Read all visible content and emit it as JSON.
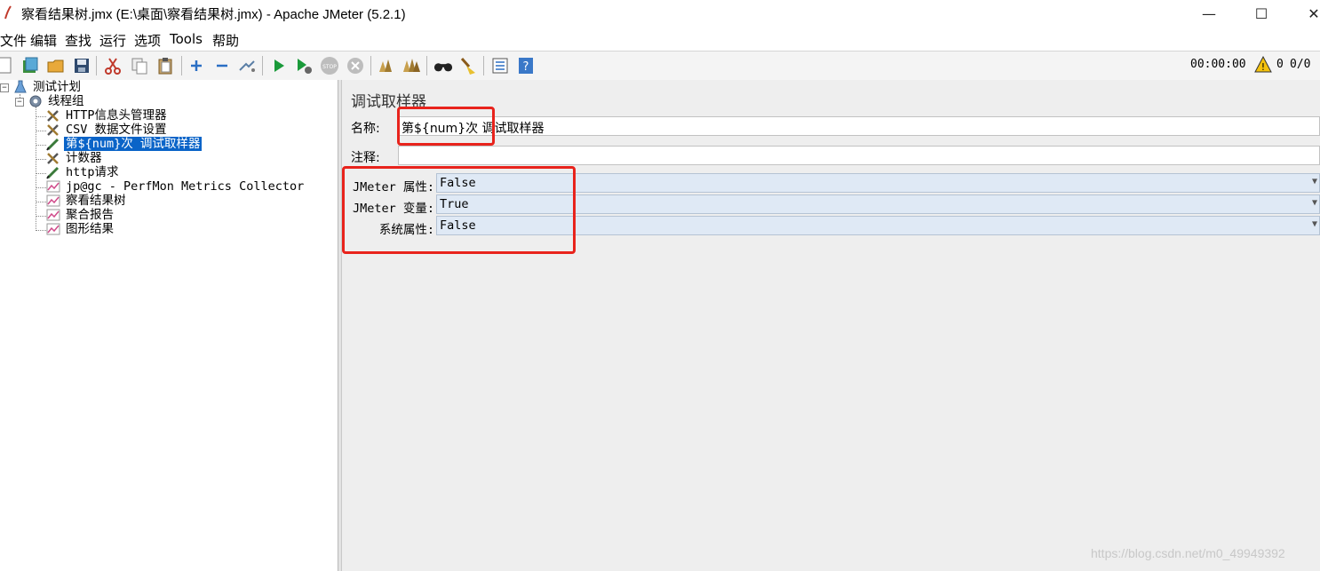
{
  "window": {
    "title": "察看结果树.jmx (E:\\桌面\\察看结果树.jmx) - Apache JMeter (5.2.1)",
    "minimize": "—",
    "maximize": "☐",
    "close": "✕"
  },
  "menu": [
    "文件",
    "编辑",
    "查找",
    "运行",
    "选项",
    "Tools",
    "帮助"
  ],
  "toolbar": {
    "icons": [
      "new-icon",
      "templates-icon",
      "open-icon",
      "save-icon",
      "cut-icon",
      "copy-icon",
      "paste-icon",
      "expand-icon",
      "collapse-icon",
      "toggle-icon",
      "start-icon",
      "start-no-pause-icon",
      "stop-icon",
      "shutdown-icon",
      "clear-icon",
      "clear-all-icon",
      "search-icon",
      "reset-search-icon",
      "function-helper-icon",
      "help-icon"
    ],
    "timer": "00:00:00",
    "warning_count": "0",
    "threads": "0/0"
  },
  "tree": {
    "items": [
      {
        "label": "测试计划",
        "icon": "test-plan-icon"
      },
      {
        "label": "线程组",
        "icon": "thread-group-icon"
      },
      {
        "label": "HTTP信息头管理器",
        "icon": "config-element-icon"
      },
      {
        "label": "CSV 数据文件设置",
        "icon": "config-element-icon"
      },
      {
        "label": "第${num}次 调试取样器",
        "icon": "sampler-icon"
      },
      {
        "label": "计数器",
        "icon": "config-element-icon"
      },
      {
        "label": "http请求",
        "icon": "sampler-icon"
      },
      {
        "label": "jp@gc - PerfMon Metrics Collector",
        "icon": "listener-icon"
      },
      {
        "label": "察看结果树",
        "icon": "listener-icon"
      },
      {
        "label": "聚合报告",
        "icon": "listener-icon"
      },
      {
        "label": "图形结果",
        "icon": "listener-icon"
      }
    ],
    "selected_index": 4
  },
  "panel": {
    "title": "调试取样器",
    "name_label": "名称:",
    "name_value": "第${num}次 调试取样器",
    "comment_label": "注释:",
    "comment_value": "",
    "properties": [
      {
        "label": "JMeter 属性:",
        "value": "False"
      },
      {
        "label": "JMeter 变量:",
        "value": "True"
      },
      {
        "label": "系统属性:",
        "value": "False"
      }
    ]
  },
  "watermark": "https://blog.csdn.net/m0_49949392",
  "colors": {
    "highlight": "#e8231c",
    "selection": "#0a64c8",
    "select_bg": "#dfe9f5"
  }
}
